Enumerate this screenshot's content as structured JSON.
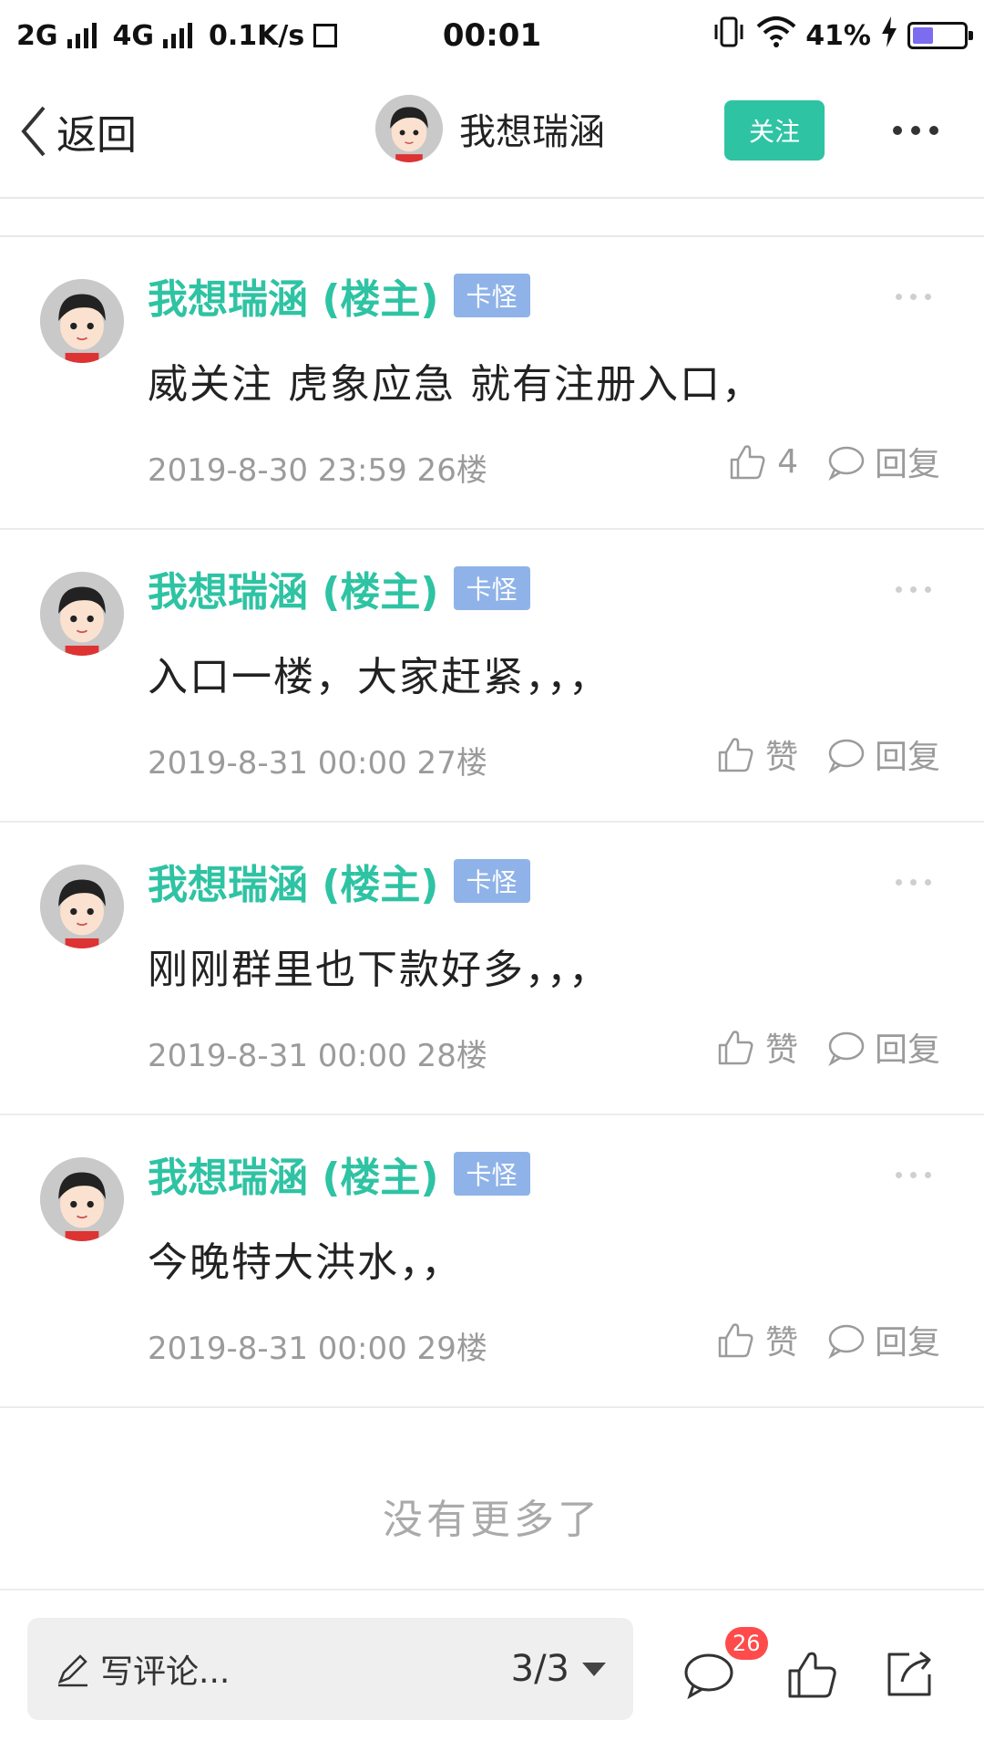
{
  "status_bar": {
    "net1": "2G",
    "net2": "4G",
    "speed": "0.1K/s",
    "time": "00:01",
    "battery_text": "41%",
    "battery_level": 0.41
  },
  "header": {
    "back_label": "返回",
    "username": "我想瑞涵",
    "follow_label": "关注"
  },
  "posts": [
    {
      "author": "我想瑞涵 (楼主)",
      "badge": "卡怪",
      "content": "威关注  虎象应急   就有注册入口，",
      "meta": "2019-8-30 23:59  26楼",
      "like_label": "4",
      "reply_label": "回复"
    },
    {
      "author": "我想瑞涵 (楼主)",
      "badge": "卡怪",
      "content": "入口一楼，大家赶紧，，，",
      "meta": "2019-8-31 00:00  27楼",
      "like_label": "赞",
      "reply_label": "回复"
    },
    {
      "author": "我想瑞涵 (楼主)",
      "badge": "卡怪",
      "content": "刚刚群里也下款好多，，，",
      "meta": "2019-8-31 00:00  28楼",
      "like_label": "赞",
      "reply_label": "回复"
    },
    {
      "author": "我想瑞涵 (楼主)",
      "badge": "卡怪",
      "content": "今晚特大洪水，，",
      "meta": "2019-8-31 00:00  29楼",
      "like_label": "赞",
      "reply_label": "回复"
    }
  ],
  "footer_note": "没有更多了",
  "bottom_bar": {
    "comment_placeholder": "写评论...",
    "page_indicator": "3/3",
    "comment_count": "26"
  },
  "colors": {
    "accent": "#2ec3a3",
    "badge": "#8fb3e8",
    "notification": "#ff4b4b"
  }
}
